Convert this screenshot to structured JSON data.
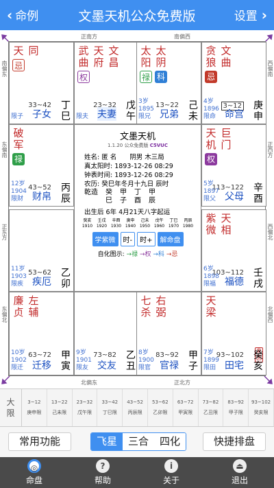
{
  "header": {
    "back_label": "命例",
    "title": "文墨天机公众免费版",
    "settings_label": "设置"
  },
  "directions": {
    "top1": "正南方",
    "top2": "南偏西",
    "bottom1": "北偏东",
    "bottom2": "正北方",
    "left1": "南偏东",
    "left2": "东偏南",
    "left3": "正东方",
    "left4": "东偏北",
    "right1": "西偏南",
    "right2": "正西方",
    "right3": "西偏北",
    "right4": "北偏西"
  },
  "palaces": [
    {
      "stars": [
        {
          "n": "天",
          "c": "red"
        },
        {
          "n": "同",
          "c": "red"
        }
      ],
      "hua": [
        {
          "t": "忌",
          "k": "o-ji"
        }
      ],
      "ages": "33~42",
      "bl1": "",
      "bl2": "限子",
      "palace": "子女",
      "gz": "丁巳"
    },
    {
      "stars": [
        {
          "n": "武曲",
          "c": "red"
        },
        {
          "n": "天府",
          "c": "red"
        },
        {
          "n": "文昌",
          "c": "red"
        }
      ],
      "hua": [
        {
          "t": "权",
          "k": "o-quan"
        }
      ],
      "ages": "23~32",
      "bl1": "",
      "bl2": "限夫",
      "palace": "夫妻",
      "gz": "戊午"
    },
    {
      "stars": [
        {
          "n": "太阳",
          "c": "red"
        },
        {
          "n": "太阴",
          "c": "red"
        }
      ],
      "hua": [
        {
          "t": "禄",
          "k": "o-lu"
        },
        {
          "t": "科",
          "k": "ke"
        }
      ],
      "ages": "13~22",
      "bl1": "3岁",
      "bl2": "1895",
      "bl3": "限兄",
      "palace": "兄弟",
      "gz": "己未"
    },
    {
      "stars": [
        {
          "n": "贪狼",
          "c": "red"
        },
        {
          "n": "文曲",
          "c": "red"
        }
      ],
      "hua": [
        {
          "t": "忌",
          "k": "ji"
        }
      ],
      "ages": "3~12",
      "bl1": "4岁",
      "bl2": "1896",
      "bl3": "限命",
      "palace": "命宫",
      "gz": "庚申"
    },
    {
      "stars": [
        {
          "n": "破军",
          "c": "red"
        }
      ],
      "hua": [
        {
          "t": "禄",
          "k": "lu"
        }
      ],
      "ages": "43~52",
      "bl1": "12岁",
      "bl2": "1904",
      "bl3": "限财",
      "palace": "财帛",
      "gz": "丙辰"
    },
    {
      "stars": [
        {
          "n": "天机",
          "c": "red"
        },
        {
          "n": "巨门",
          "c": "red"
        }
      ],
      "hua": [
        {
          "t": "权",
          "k": "quan"
        }
      ],
      "ages": "113~122",
      "bl1": "5岁",
      "bl2": "1897",
      "bl3": "限父",
      "palace": "父母",
      "gz": "辛酉"
    },
    {
      "stars": [],
      "hua": [],
      "ages": "53~62",
      "bl1": "11岁",
      "bl2": "1903",
      "bl3": "限疾",
      "palace": "疾厄",
      "gz": "乙卯"
    },
    {
      "stars": [
        {
          "n": "紫微",
          "c": "red"
        },
        {
          "n": "天相",
          "c": "red"
        }
      ],
      "hua": [],
      "ages": "103~112",
      "bl1": "6岁",
      "bl2": "1898",
      "bl3": "限福",
      "palace": "福德",
      "gz": "壬戌"
    },
    {
      "stars": [
        {
          "n": "廉贞",
          "c": "red"
        },
        {
          "n": "左辅",
          "c": "red"
        }
      ],
      "hua": [],
      "ages": "63~72",
      "bl1": "10岁",
      "bl2": "1902",
      "bl3": "限迁",
      "palace": "迁移",
      "gz": "甲寅"
    },
    {
      "stars": [],
      "hua": [],
      "ages": "73~82",
      "bl1": "9岁",
      "bl2": "1901",
      "bl3": "限友",
      "palace": "交友",
      "gz": "乙丑"
    },
    {
      "stars": [
        {
          "n": "七杀",
          "c": "red"
        },
        {
          "n": "右弼",
          "c": "red"
        }
      ],
      "hua": [],
      "ages": "83~92",
      "bl1": "8岁",
      "bl2": "1900",
      "bl3": "限官",
      "palace": "官禄",
      "gz": "甲子"
    },
    {
      "stars": [
        {
          "n": "天梁",
          "c": "red"
        }
      ],
      "hua": [],
      "laiyin": "来因",
      "ages": "93~102",
      "bl1": "7岁",
      "bl2": "1899",
      "bl3": "限田",
      "palace": "田宅",
      "gz": "癸亥"
    }
  ],
  "center": {
    "title": "文墨天机",
    "sub": "1.1.20 公众免费版",
    "code": "C5VUC",
    "lines": [
      "姓名: 匿 名　　阴男 木三局",
      "真太阳时: 1893-12-26 08:29",
      "钟表时间: 1893-12-26 08:29",
      "农历: 癸巳年冬月十九日 辰时"
    ],
    "pillars_label": "乾造",
    "pillars": [
      [
        "癸",
        "巳"
      ],
      [
        "甲",
        "子"
      ],
      [
        "丁",
        "酉"
      ],
      [
        "甲",
        "辰"
      ]
    ],
    "qiyun": "出生后 6年 4月21天八字起运",
    "dayun_gz": [
      "癸亥",
      "壬戌",
      "辛酉",
      "庚申",
      "己未",
      "戊午",
      "丁巳",
      "丙辰"
    ],
    "dayun_years": [
      "1910",
      "1920",
      "1930",
      "1940",
      "1950",
      "1960",
      "1970",
      "1980"
    ],
    "btn1": "学紫微",
    "btn2": "时-",
    "btn3": "时+",
    "btn4": "解命盘",
    "chain_label": "自化图示:",
    "chain": [
      "→禄",
      "→权",
      "→科",
      "→忌"
    ]
  },
  "daxian": {
    "label1": "大",
    "label2": "限",
    "items": [
      [
        "3~12",
        "庚申限"
      ],
      [
        "13~22",
        "己未限"
      ],
      [
        "23~32",
        "戊午限"
      ],
      [
        "33~42",
        "丁巳限"
      ],
      [
        "43~52",
        "丙辰限"
      ],
      [
        "53~62",
        "乙卯限"
      ],
      [
        "63~72",
        "甲寅限"
      ],
      [
        "73~82",
        "乙丑限"
      ],
      [
        "83~92",
        "甲子限"
      ],
      [
        "93~102",
        "癸亥限"
      ]
    ]
  },
  "toolbar": {
    "common": "常用功能",
    "seg": [
      "飞星",
      "三合",
      "四化"
    ],
    "quick": "快捷排盘"
  },
  "nav": [
    {
      "label": "命盘",
      "icon": "chart-icon"
    },
    {
      "label": "帮助",
      "icon": "help-icon"
    },
    {
      "label": "关于",
      "icon": "info-icon"
    },
    {
      "label": "退出",
      "icon": "exit-icon"
    }
  ],
  "colors": {
    "primary": "#3f8ff0",
    "star": "#c22a2a",
    "palace": "#1a4fc0"
  }
}
